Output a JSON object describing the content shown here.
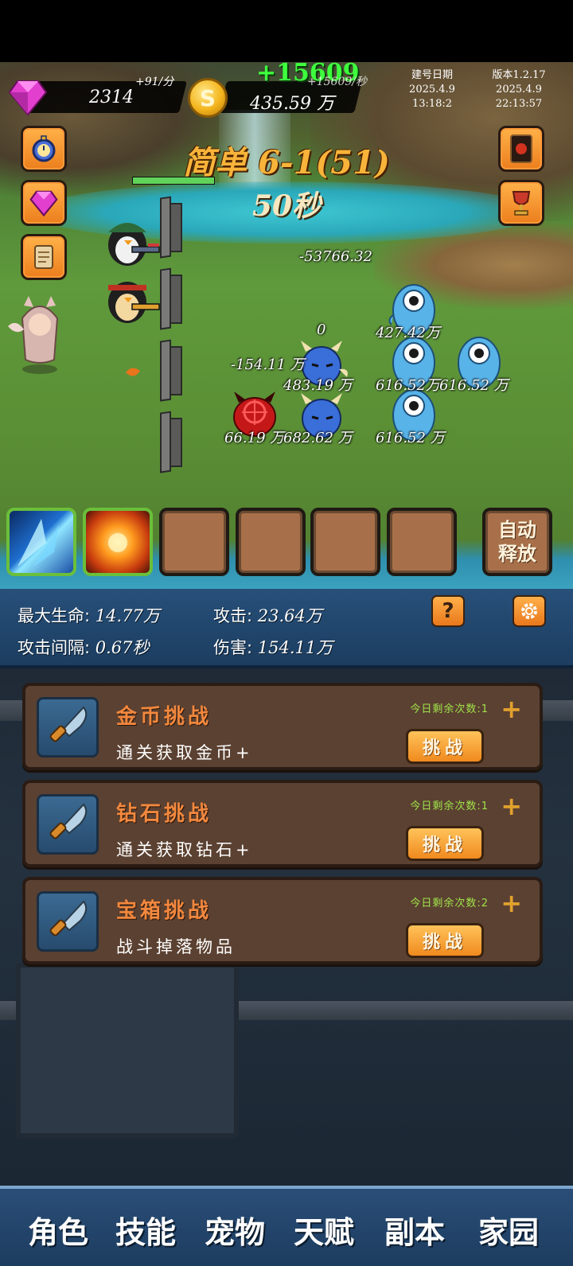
{
  "resources": {
    "gems": "2314",
    "gem_rate": "+91/分",
    "coin_gain": "+15609",
    "coin_rate": "+15609/秒",
    "gold": "435.59 万"
  },
  "build_info": {
    "date_label": "建号日期",
    "date": "2025.4.9",
    "time": "13:18:2",
    "version_label": "版本1.2.17",
    "version_date": "2025.4.9",
    "version_time": "22:13:57"
  },
  "stage": {
    "title": "简单 6-1(51)",
    "timer": "50秒"
  },
  "damage_numbers": {
    "d1": "-53766.32",
    "d2": "0",
    "d3": "-154.11 万",
    "hp_e1": "427.42万",
    "hp_e2": "483.19 万",
    "hp_e3": "616.52万",
    "hp_e4": "616.52 万",
    "hp_e5": "616.52 万",
    "hp_e6": "66.19 万",
    "hp_e7": "682.62 万"
  },
  "skills": {
    "auto_line1": "自动",
    "auto_line2": "释放"
  },
  "stats": {
    "max_hp_label": "最大生命:",
    "max_hp": "14.77万",
    "attack_label": "攻击:",
    "attack": "23.64万",
    "interval_label": "攻击间隔:",
    "interval": "0.67秒",
    "damage_label": "伤害:",
    "damage": "154.11万",
    "help_label": "?"
  },
  "challenges": [
    {
      "title": "金币挑战",
      "desc": "通关获取金币+",
      "remaining": "今日剩余次数:1",
      "button": "挑战"
    },
    {
      "title": "钻石挑战",
      "desc": "通关获取钻石+",
      "remaining": "今日剩余次数:1",
      "button": "挑战"
    },
    {
      "title": "宝箱挑战",
      "desc": "战斗掉落物品",
      "remaining": "今日剩余次数:2",
      "button": "挑战"
    }
  ],
  "nav": [
    "角色",
    "技能",
    "宠物",
    "天赋",
    "副本",
    "家园"
  ],
  "colors": {
    "accent_orange": "#f08a1e",
    "title_orange": "#f2883e",
    "remaining_green": "#9fe34a",
    "panel_blue": "#27507a",
    "card_brown": "#5b4131"
  },
  "icons": [
    "gem-icon",
    "coin-icon",
    "stopwatch-icon",
    "scroll-icon",
    "card-deck-icon",
    "trophy-icon",
    "ice-skill-icon",
    "fire-skill-icon",
    "knife-icon",
    "gear-icon",
    "plus-icon"
  ]
}
